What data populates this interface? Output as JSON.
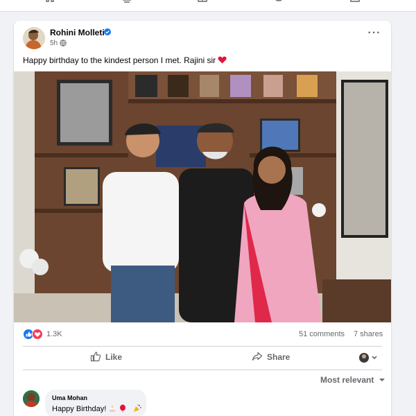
{
  "post": {
    "author_name": "Rohini Molleti",
    "time": "5h",
    "text": "Happy birthday to the kindest person I met. Rajini sir"
  },
  "stats": {
    "reactions": "1.3K",
    "comments": "51 comments",
    "shares": "7 shares"
  },
  "actions": {
    "like_label": "Like",
    "share_label": "Share"
  },
  "comments_section": {
    "sort_label": "Most relevant",
    "comments": [
      {
        "author": "Uma Mohan",
        "text": "Happy Birthday!"
      }
    ]
  },
  "icons": {
    "topbar": [
      "home-icon",
      "video-icon",
      "marketplace-icon",
      "groups-icon",
      "gaming-icon"
    ],
    "post": [
      "verified-badge-icon",
      "globe-icon",
      "more-options-icon",
      "heart-emoji-icon"
    ],
    "reactions": [
      "like-reaction-icon",
      "love-reaction-icon"
    ],
    "actions": [
      "like-icon",
      "share-icon",
      "chevron-down-icon"
    ]
  },
  "colors": {
    "accent": "#1877f2",
    "love": "#f33e58",
    "text_secondary": "#65676b",
    "background": "#f0f2f5"
  }
}
